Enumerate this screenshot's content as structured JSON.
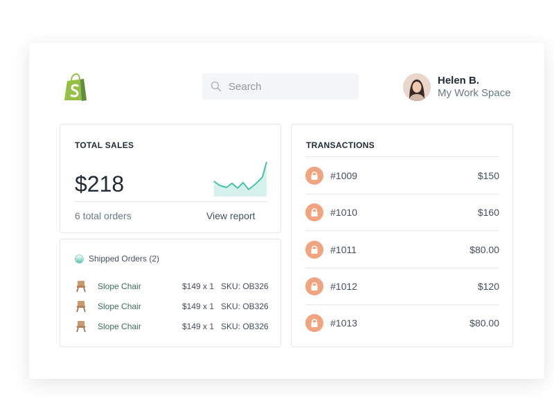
{
  "header": {
    "search_placeholder": "Search",
    "user_name": "Helen B.",
    "user_workspace": "My Work Space"
  },
  "sales": {
    "title": "TOTAL SALES",
    "value": "$218",
    "orders": "6 total orders",
    "view_report": "View report"
  },
  "shipped": {
    "title": "Shipped Orders (2)",
    "items": [
      {
        "name": "Slope Chair",
        "price": "$149 x 1",
        "sku": "SKU: OB326"
      },
      {
        "name": "Slope Chair",
        "price": "$149 x 1",
        "sku": "SKU: OB326"
      },
      {
        "name": "Slope Chair",
        "price": "$149 x 1",
        "sku": "SKU: OB326"
      }
    ]
  },
  "transactions": {
    "title": "TRANSACTIONS",
    "items": [
      {
        "id": "#1009",
        "amount": "$150"
      },
      {
        "id": "#1010",
        "amount": "$160"
      },
      {
        "id": "#1011",
        "amount": "$80.00"
      },
      {
        "id": "#1012",
        "amount": "$120"
      },
      {
        "id": "#1013",
        "amount": "$80.00"
      }
    ]
  },
  "colors": {
    "brand_green": "#95bf47",
    "accent_teal": "#47c1a8",
    "lock_orange": "#f0a580"
  },
  "icons": {
    "logo": "shopify-bag-icon",
    "search": "search-icon",
    "lock": "lock-icon",
    "chair": "chair-icon",
    "status": "shipped-status-icon"
  }
}
